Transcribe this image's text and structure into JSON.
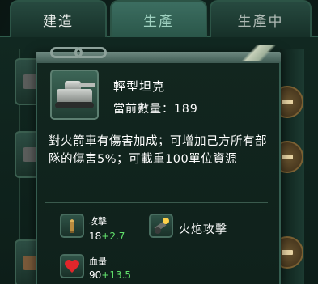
{
  "tabs": [
    {
      "label": "建造"
    },
    {
      "label": "生產"
    },
    {
      "label": "生產中"
    }
  ],
  "popup": {
    "unit_name": "輕型坦克",
    "count_label": "當前數量：",
    "count_value": "189",
    "description": "對火箭車有傷害加成；可增加己方所有部隊的傷害5%；可載重100單位資源",
    "stats": [
      {
        "label": "攻擊",
        "base": "18",
        "bonus": "+2.7",
        "icon": "bullet-icon"
      },
      {
        "label": "血量",
        "base": "90",
        "bonus": "+13.5",
        "icon": "heart-icon"
      }
    ],
    "skill": {
      "name": "火炮攻擊",
      "icon": "artillery-icon"
    }
  },
  "colors": {
    "bonus_green": "#61e06b",
    "panel_border": "#355d50",
    "background": "#0b1714"
  }
}
